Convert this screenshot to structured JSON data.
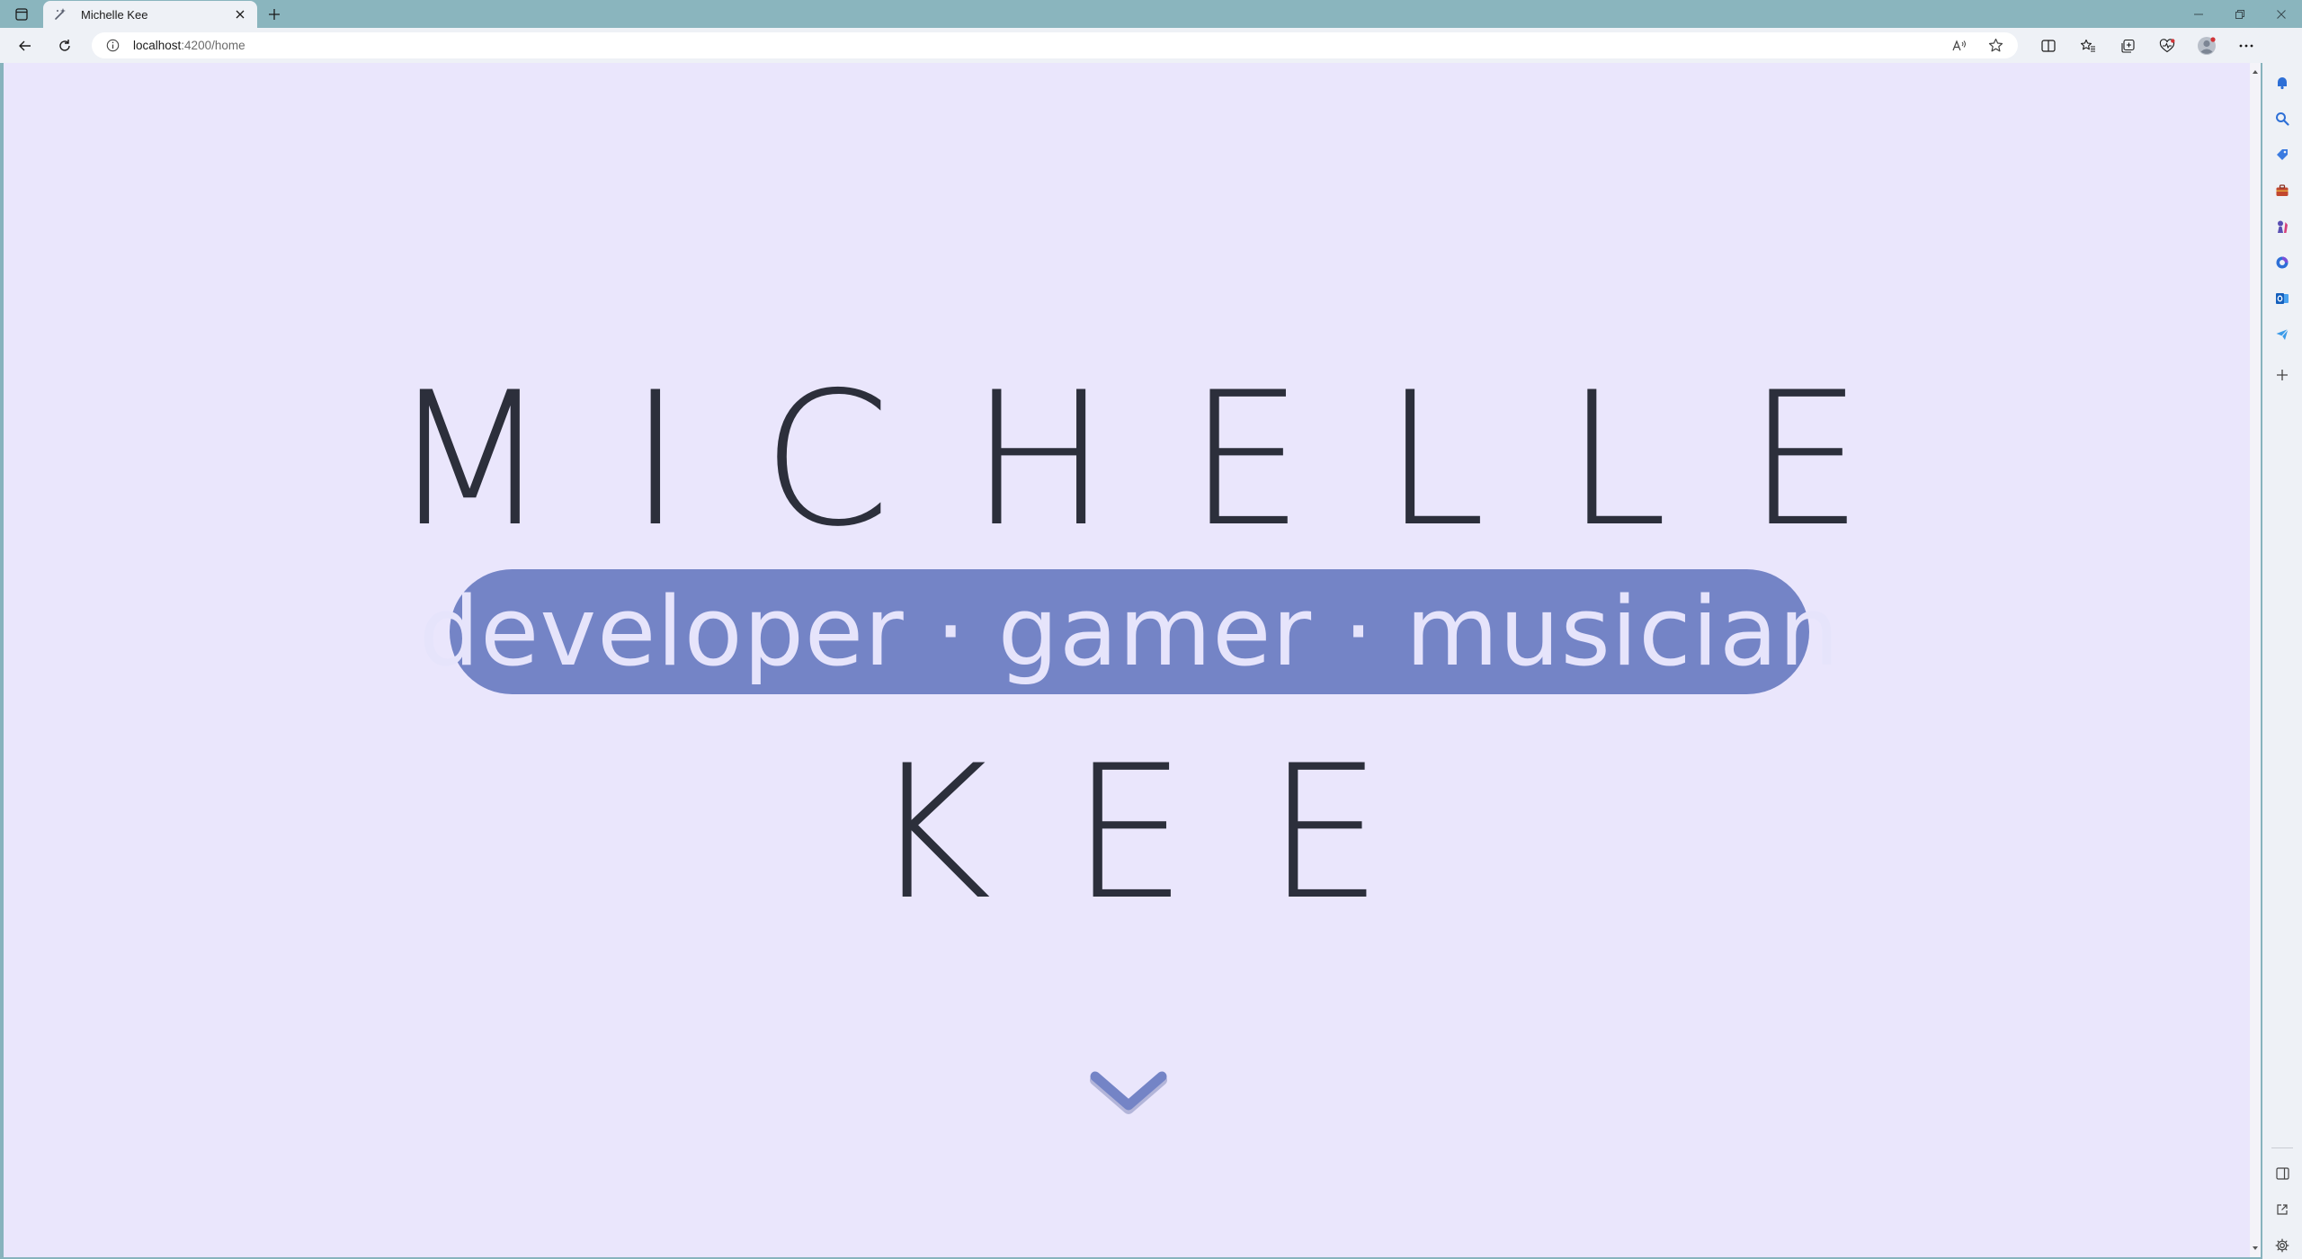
{
  "browser": {
    "tab": {
      "title": "Michelle Kee"
    },
    "address": {
      "host": "localhost",
      "path": ":4200/home"
    }
  },
  "page": {
    "name_first": "MICHELLE",
    "tagline": "developer · gamer · musician",
    "name_last": "KEE"
  },
  "colors": {
    "background": "#eae6fc",
    "accent": "#7484c6",
    "text": "#2c2f3b",
    "tagline_text": "#e6e4fb"
  },
  "icons": {
    "tab_favicon": "sparkle-icon",
    "scroll_cue": "chevron-down-icon"
  }
}
